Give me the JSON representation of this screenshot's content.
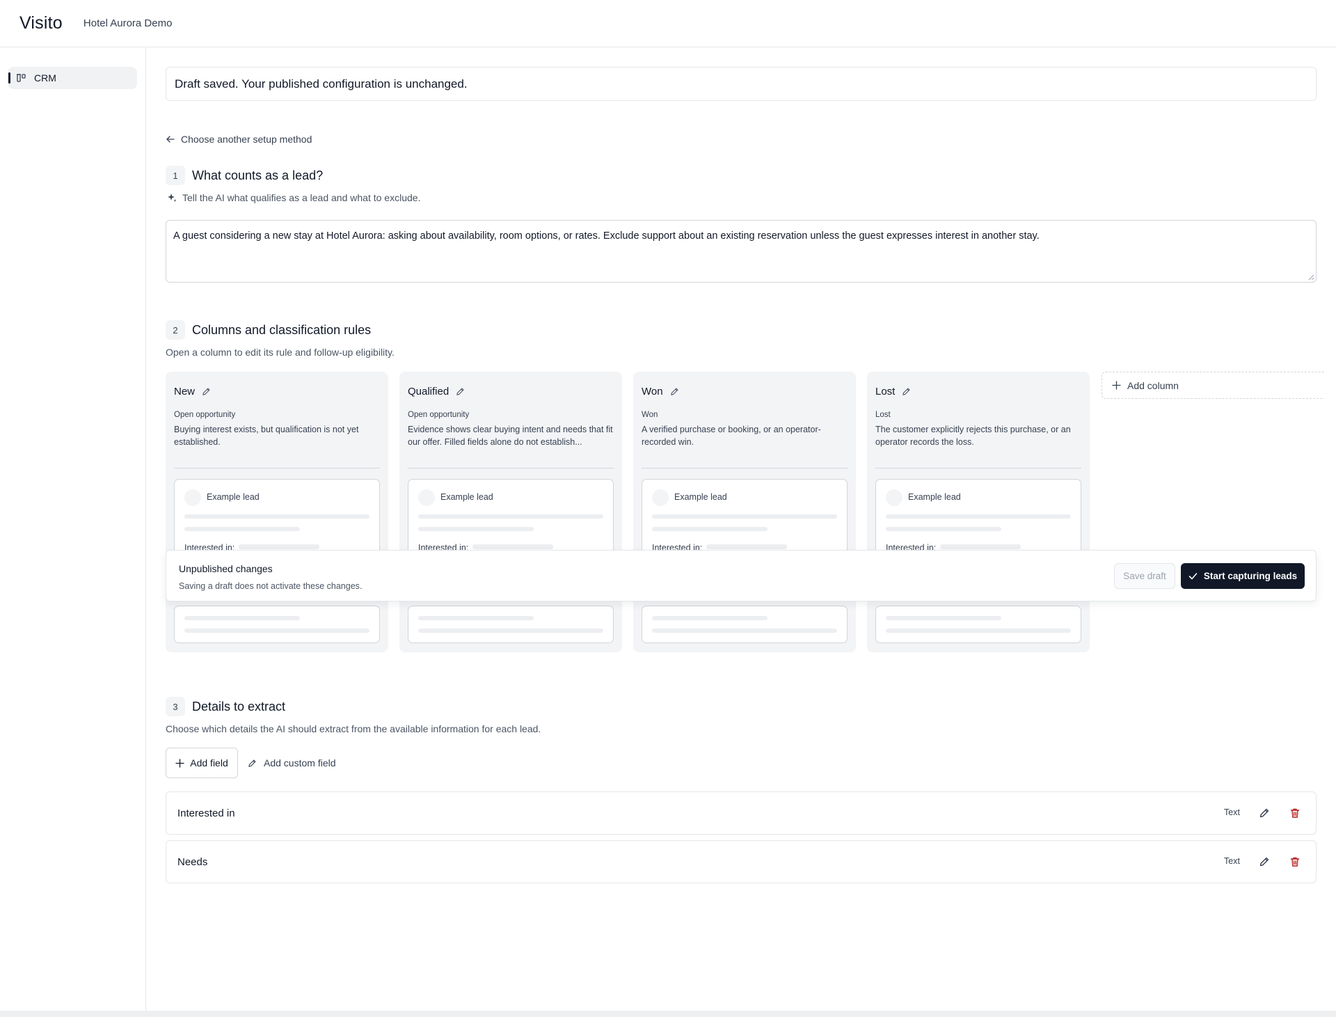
{
  "app": {
    "brand": "Visito",
    "organization": "Hotel Aurora Demo"
  },
  "sidebar": {
    "items": [
      {
        "label": "CRM",
        "icon": "crm-icon",
        "active": true
      }
    ]
  },
  "notice": {
    "text": "Draft saved. Your published configuration is unchanged."
  },
  "back_link": {
    "label": "Choose another setup method"
  },
  "section1": {
    "number": "1",
    "title": "What counts as a lead?",
    "hint": "Tell the AI what qualifies as a lead and what to exclude.",
    "definition": "A guest considering a new stay at Hotel Aurora: asking about availability, room options, or rates. Exclude support about an existing reservation unless the guest expresses interest in another stay."
  },
  "section2": {
    "number": "2",
    "title": "Columns and classification rules",
    "subtitle": "Open a column to edit its rule and follow-up eligibility.",
    "columns": [
      {
        "name": "New",
        "type": "Open opportunity",
        "description": "Buying interest exists, but qualification is not yet established.",
        "example_lead": "Example lead",
        "interested_label": "Interested in:"
      },
      {
        "name": "Qualified",
        "type": "Open opportunity",
        "description": "Evidence shows clear buying intent and needs that fit our offer. Filled fields alone do not establish...",
        "example_lead": "Example lead",
        "interested_label": "Interested in:"
      },
      {
        "name": "Won",
        "type": "Won",
        "description": "A verified purchase or booking, or an operator-recorded win.",
        "example_lead": "Example lead",
        "interested_label": "Interested in:"
      },
      {
        "name": "Lost",
        "type": "Lost",
        "description": "The customer explicitly rejects this purchase, or an operator records the loss.",
        "example_lead": "Example lead",
        "interested_label": "Interested in:"
      }
    ],
    "add_column_label": "Add column"
  },
  "publish_bar": {
    "title": "Unpublished changes",
    "subtitle": "Saving a draft does not activate these changes.",
    "save_draft_label": "Save draft",
    "start_label": "Start capturing leads"
  },
  "section3": {
    "number": "3",
    "title": "Details to extract",
    "subtitle": "Choose which details the AI should extract from the available information for each lead.",
    "add_field_label": "Add field",
    "add_custom_field_label": "Add custom field",
    "fields": [
      {
        "name": "Interested in",
        "type": "Text"
      },
      {
        "name": "Needs",
        "type": "Text"
      }
    ]
  },
  "colors": {
    "primary": "#111827",
    "column_bg": "#f3f4f6",
    "border": "#e5e7eb",
    "danger": "#b91c1c"
  }
}
